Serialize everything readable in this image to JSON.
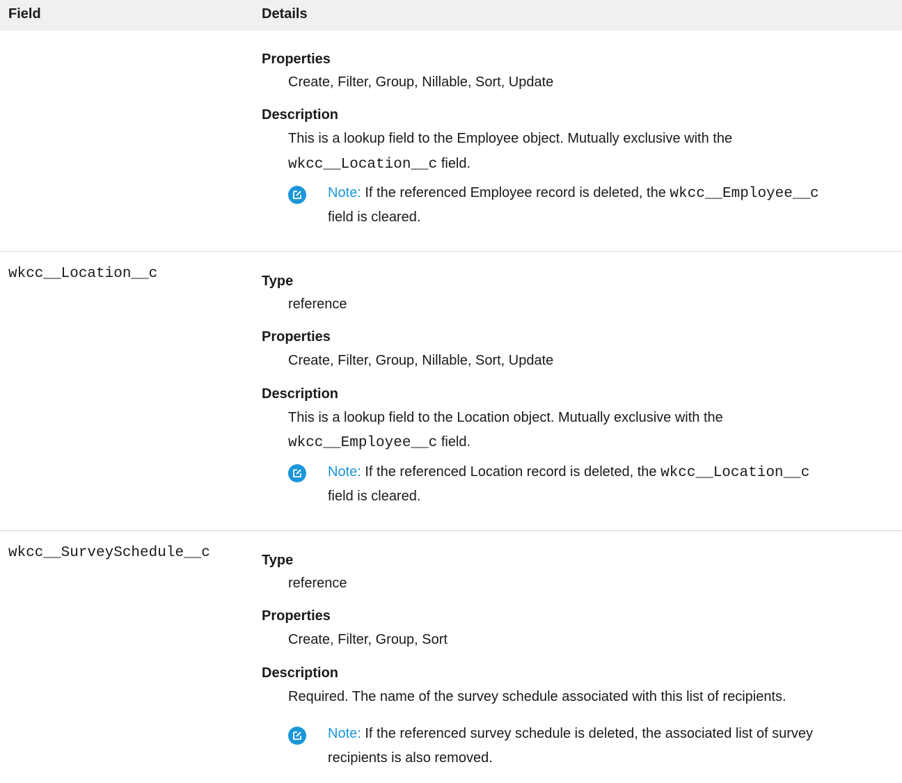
{
  "header": {
    "field": "Field",
    "details": "Details"
  },
  "rows": [
    {
      "properties_label": "Properties",
      "properties": "Create, Filter, Group, Nillable, Sort, Update",
      "description_label": "Description",
      "description_line1": "This is a lookup field to the Employee object. Mutually exclusive with the",
      "description_code": "wkcc__Location__c",
      "description_suffix": "field.",
      "note_label": "Note:",
      "note_line1_pre": "If the referenced Employee record is deleted, the",
      "note_code": "wkcc__Employee__c",
      "note_line2": "field is cleared."
    },
    {
      "field": "wkcc__Location__c",
      "type_label": "Type",
      "type": "reference",
      "properties_label": "Properties",
      "properties": "Create, Filter, Group, Nillable, Sort, Update",
      "description_label": "Description",
      "description_line1": "This is a lookup field to the Location object. Mutually exclusive with the",
      "description_code": "wkcc__Employee__c",
      "description_suffix": "field.",
      "note_label": "Note:",
      "note_line1_pre": "If the referenced Location record is deleted, the",
      "note_code": "wkcc__Location__c",
      "note_line2": "field is cleared."
    },
    {
      "field": "wkcc__SurveySchedule__c",
      "type_label": "Type",
      "type": "reference",
      "properties_label": "Properties",
      "properties": "Create, Filter, Group, Sort",
      "description_label": "Description",
      "description_line1": "Required. The name of the survey schedule associated with this list of recipients.",
      "note_label": "Note:",
      "note_line1_pre": "If the referenced survey schedule is deleted, the associated list of survey",
      "note_line2": "recipients is also removed."
    }
  ],
  "colors": {
    "accent": "#1b96d9",
    "header_bg": "#f0f0f0",
    "divider": "#d8d8d8"
  },
  "icons": {
    "note": "edit-note-icon"
  }
}
